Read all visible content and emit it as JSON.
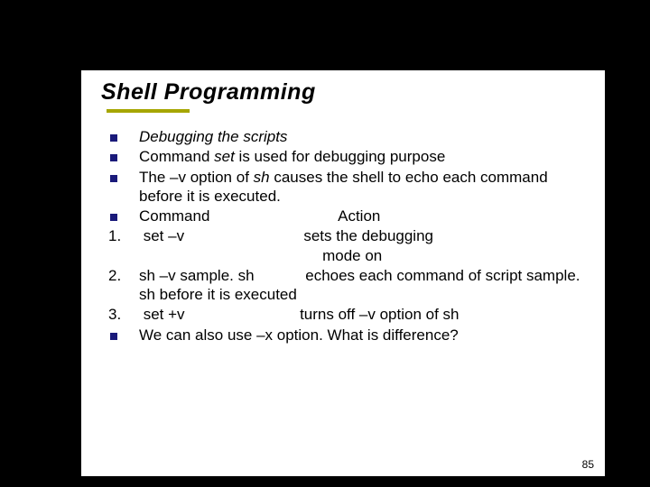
{
  "title": "Shell Programming",
  "bullets": {
    "b1_html": "<span class=\"ital\">Debugging the scripts</span>",
    "b2_html": "Command <span class=\"ital\">set</span> is used for debugging purpose",
    "b3_html": "The –v option of <span class=\"ital\">sh </span> causes the shell to echo each command before it is executed.",
    "b4_html": "Command&nbsp;&nbsp;&nbsp;&nbsp;&nbsp;&nbsp;&nbsp;&nbsp;&nbsp;&nbsp;&nbsp;&nbsp;&nbsp;&nbsp;&nbsp;&nbsp;&nbsp;&nbsp;&nbsp;&nbsp;&nbsp;&nbsp;&nbsp;&nbsp;&nbsp;&nbsp;&nbsp;&nbsp;&nbsp;&nbsp;Action",
    "n1_html": "&nbsp;set –v&nbsp;&nbsp;&nbsp;&nbsp;&nbsp;&nbsp;&nbsp;&nbsp;&nbsp;&nbsp;&nbsp;&nbsp;&nbsp;&nbsp;&nbsp;&nbsp;&nbsp;&nbsp;&nbsp;&nbsp;&nbsp;&nbsp;&nbsp;&nbsp;&nbsp;&nbsp;&nbsp;&nbsp;sets the debugging<br>&nbsp;&nbsp;&nbsp;&nbsp;&nbsp;&nbsp;&nbsp;&nbsp;&nbsp;&nbsp;&nbsp;&nbsp;&nbsp;&nbsp;&nbsp;&nbsp;&nbsp;&nbsp;&nbsp;&nbsp;&nbsp;&nbsp;&nbsp;&nbsp;&nbsp;&nbsp;&nbsp;&nbsp;&nbsp;&nbsp;&nbsp;&nbsp;&nbsp;&nbsp;&nbsp;&nbsp;&nbsp;&nbsp;&nbsp;&nbsp;&nbsp;&nbsp;&nbsp;mode on",
    "n2_html": "sh –v sample. sh&nbsp;&nbsp;&nbsp;&nbsp;&nbsp;&nbsp;&nbsp;&nbsp;&nbsp;&nbsp;&nbsp;&nbsp;echoes each command of script sample. sh before it is executed",
    "n3_html": "&nbsp;set +v&nbsp;&nbsp;&nbsp;&nbsp;&nbsp;&nbsp;&nbsp;&nbsp;&nbsp;&nbsp;&nbsp;&nbsp;&nbsp;&nbsp;&nbsp;&nbsp;&nbsp;&nbsp;&nbsp;&nbsp;&nbsp;&nbsp;&nbsp;&nbsp;&nbsp;&nbsp;&nbsp;turns off –v option of sh",
    "b5_html": "We can also use –x option. What is difference?"
  },
  "markers": {
    "n1": "1.",
    "n2": "2.",
    "n3": "3."
  },
  "page_number": "85"
}
